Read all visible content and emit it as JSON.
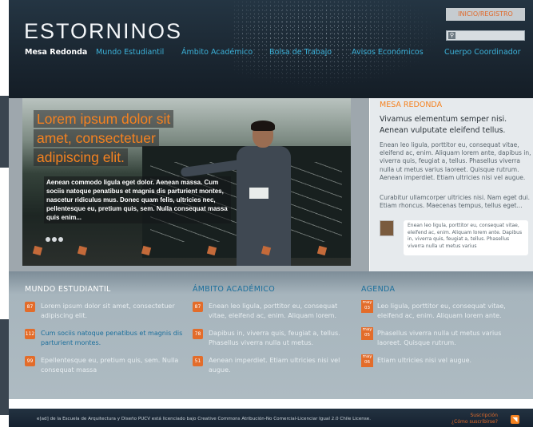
{
  "header": {
    "logo": "ESTORNINOS",
    "login_label": "INICIO/REGISTRO",
    "search_placeholder": "",
    "nav": [
      {
        "label": "Mesa Redonda",
        "active": true
      },
      {
        "label": "Mundo Estudiantil",
        "active": false
      },
      {
        "label": "Ámbito Académico",
        "active": false
      },
      {
        "label": "Bolsa de Trabajo",
        "active": false
      },
      {
        "label": "Avisos Económicos",
        "active": false
      },
      {
        "label": "Cuerpo Coordinador",
        "active": false
      }
    ]
  },
  "hero": {
    "headline_lines": [
      "Lorem ipsum dolor sit",
      "amet, consectetuer",
      "adipiscing elit."
    ],
    "text": "Aenean commodo ligula eget dolor. Aenean massa. Cum sociis natoque penatibus et magnis dis parturient montes, nascetur ridiculus mus. Donec quam felis, ultricies nec, pellentesque eu, pretium quis, sem. Nulla consequat massa quis enim..."
  },
  "sidebar": {
    "kicker": "MESA REDONDA",
    "subtitle": "Vivamus elementum semper nisi. Aenean vulputate eleifend tellus.",
    "paragraph1": "Enean leo ligula, porttitor eu, consequat vitae, eleifend ac, enim. Aliquam lorem ante, dapibus in, viverra quis, feugiat a, tellus. Phasellus viverra nulla ut metus varius laoreet. Quisque rutrum. Aenean imperdiet. Etiam ultricies nisi vel augue.",
    "paragraph2": "Curabitur ullamcorper ultricies nisi. Nam eget dui. Etiam rhoncus. Maecenas tempus, tellus eget...",
    "quote": "Enean leo ligula, porttitor eu, consequat vitae, eleifend ac, enim. Aliquam lorem ante. Dapibus in, viverra quis, feugiat a, tellus. Phasellus viverra nulla ut metus varius"
  },
  "columns": {
    "mundo": {
      "heading": "MUNDO ESTUDIANTIL",
      "items": [
        {
          "badge": "87",
          "text": "Lorem ipsum dolor sit amet, consectetuer adipiscing elit."
        },
        {
          "badge": "112",
          "text": "Cum sociis natoque penatibus et magnis dis parturient montes."
        },
        {
          "badge": "99",
          "text": "Epellentesque eu, pretium quis, sem. Nulla consequat massa"
        }
      ]
    },
    "ambito": {
      "heading": "ÁMBITO ACADÉMICO",
      "items": [
        {
          "badge": "87",
          "text": "Enean leo ligula, porttitor eu, consequat vitae, eleifend ac, enim. Aliquam lorem."
        },
        {
          "badge": "78",
          "text": "Dapibus in, viverra quis, feugiat a, tellus. Phasellus viverra nulla ut metus."
        },
        {
          "badge": "51",
          "text": "Aenean imperdiet. Etiam ultricies nisi vel augue."
        }
      ]
    },
    "agenda": {
      "heading": "AGENDA",
      "items": [
        {
          "month": "may",
          "day": "03",
          "text": "Leo ligula, porttitor eu, consequat vitae, eleifend ac, enim. Aliquam lorem ante."
        },
        {
          "month": "may",
          "day": "05",
          "text": "Phasellus viverra nulla ut metus varius laoreet. Quisque rutrum."
        },
        {
          "month": "may",
          "day": "06",
          "text": "Etiam ultricies nisi vel augue."
        }
      ]
    }
  },
  "footer": {
    "license": "e[ad] de la Escuela de Arquitectura y Diseño PUCV está licenciado bajo Creative Commons Atribución-No Comercial-Licenciar Igual 2.0 Chile License.",
    "subscription": "Suscripción",
    "subscribe_question": "¿Cómo suscribirse?"
  },
  "colors": {
    "accent": "#f58220",
    "link": "#3cb1d8",
    "header_bg": "#1b2732"
  }
}
